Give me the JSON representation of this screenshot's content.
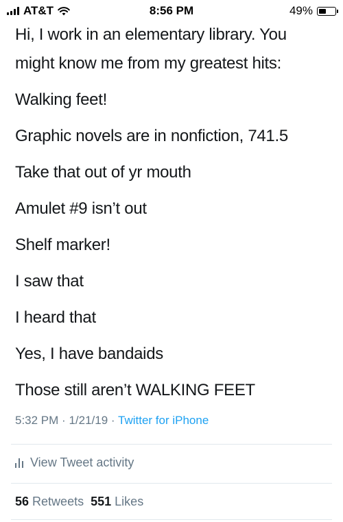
{
  "status_bar": {
    "carrier": "AT&T",
    "time": "8:56 PM",
    "battery_percent": "49%",
    "battery_level": 0.49
  },
  "tweet": {
    "lines": [
      "Hi, I work in an elementary library. You",
      "might know me from my greatest hits:",
      "Walking feet!",
      "Graphic novels are in nonfiction, 741.5",
      "Take that out of yr mouth",
      "Amulet #9 isn’t out",
      "Shelf marker!",
      "I saw that",
      "I heard that",
      "Yes, I have bandaids",
      "Those still aren’t WALKING FEET"
    ],
    "time": "5:32 PM",
    "date": "1/21/19",
    "separator": "·",
    "source": "Twitter for iPhone"
  },
  "activity": {
    "label": "View Tweet activity",
    "icon": "bar-chart-icon"
  },
  "stats": {
    "retweets_count": "56",
    "retweets_label": "Retweets",
    "likes_count": "551",
    "likes_label": "Likes"
  },
  "colors": {
    "text": "#14171a",
    "secondary": "#657786",
    "link": "#1da1f2",
    "divider": "#e1e8ed"
  }
}
